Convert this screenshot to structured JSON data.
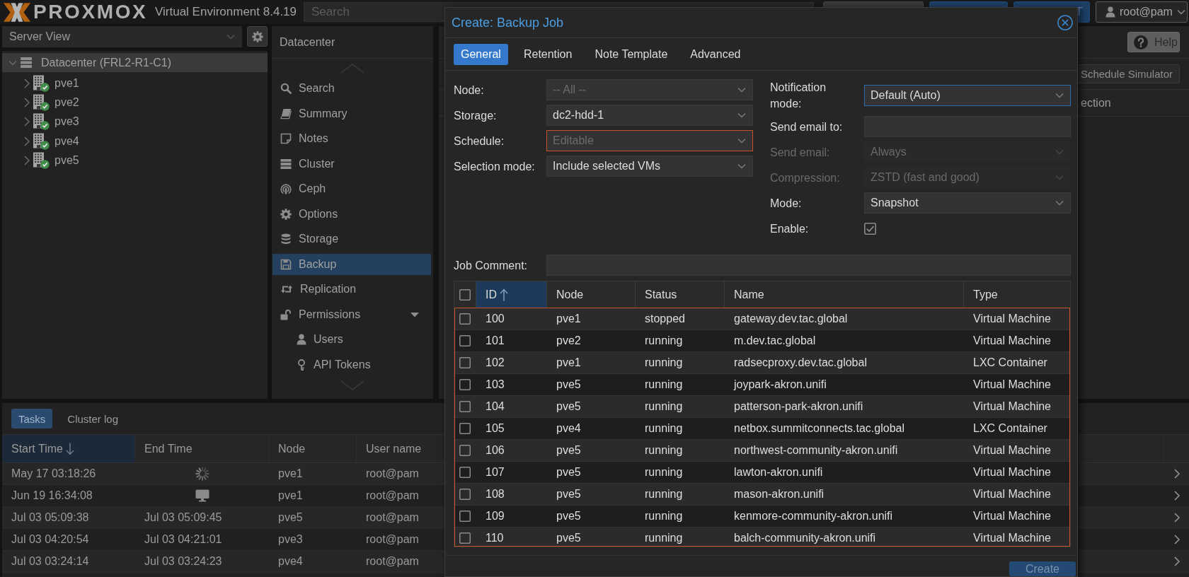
{
  "header": {
    "logo": "PROXMOX",
    "version": "Virtual Environment 8.4.19",
    "search": {
      "placeholder": "Search"
    },
    "buttons": [
      {
        "kind": "plain"
      },
      {
        "kind": "primary"
      },
      {
        "kind": "primary",
        "label": "T"
      }
    ],
    "user": "root@pam"
  },
  "tree": {
    "view": "Server View",
    "items": [
      {
        "label": "Datacenter (FRL2-R1-C1)",
        "selected": true,
        "expanded": true,
        "children": [
          {
            "label": "pve1",
            "selected": false,
            "expanded": false
          },
          {
            "label": "pve2",
            "selected": false,
            "expanded": false
          },
          {
            "label": "pve3",
            "selected": false,
            "expanded": false
          },
          {
            "label": "pve4",
            "selected": false,
            "expanded": false
          },
          {
            "label": "pve5",
            "selected": false,
            "expanded": false
          }
        ]
      }
    ]
  },
  "nav": {
    "title": "Datacenter",
    "items": [
      {
        "label": "Search",
        "selected": false
      },
      {
        "label": "Summary",
        "selected": false
      },
      {
        "label": "Notes",
        "selected": false
      },
      {
        "label": "Cluster",
        "selected": false
      },
      {
        "label": "Ceph",
        "selected": false
      },
      {
        "label": "Options",
        "selected": false
      },
      {
        "label": "Storage",
        "selected": false
      },
      {
        "label": "Backup",
        "selected": true
      },
      {
        "label": "Replication",
        "selected": false
      },
      {
        "label": "Permissions",
        "selected": false,
        "expanded": true,
        "children": [
          {
            "label": "Users",
            "selected": false
          },
          {
            "label": "API Tokens",
            "selected": false
          }
        ]
      }
    ]
  },
  "content": {
    "help_button": "Help",
    "simulator_button": "Schedule Simulator",
    "column_header": "ection"
  },
  "tasks": {
    "tabs": [
      {
        "label": "Tasks",
        "selected": true
      },
      {
        "label": "Cluster log",
        "selected": false
      }
    ],
    "columns": [
      {
        "label": "Start Time",
        "sorted": true,
        "descending": true
      },
      {
        "label": "End Time",
        "sorted": false
      },
      {
        "label": "Node",
        "sorted": false
      },
      {
        "label": "User name",
        "sorted": false
      }
    ],
    "rows": [
      {
        "start": "May 17 03:18:26",
        "kind": "running",
        "node": "pve1",
        "user": "root@pam"
      },
      {
        "start": "Jun 19 16:34:08",
        "kind": "console",
        "node": "pve1",
        "user": "root@pam"
      },
      {
        "start": "Jul 03 05:09:38",
        "kind": "finished",
        "end": "Jul 03 05:09:45",
        "node": "pve5",
        "user": "root@pam"
      },
      {
        "start": "Jul 03 04:20:54",
        "kind": "finished",
        "end": "Jul 03 04:21:01",
        "node": "pve3",
        "user": "root@pam"
      },
      {
        "start": "Jul 03 03:24:14",
        "kind": "finished",
        "end": "Jul 03 03:24:23",
        "node": "pve4",
        "user": "root@pam"
      }
    ]
  },
  "dialog": {
    "title": "Create: Backup Job",
    "tabs": [
      {
        "label": "General",
        "selected": true
      },
      {
        "label": "Retention",
        "selected": false
      },
      {
        "label": "Note Template",
        "selected": false
      },
      {
        "label": "Advanced",
        "selected": false
      }
    ],
    "left_fields": [
      {
        "label": "Node:",
        "kind": "combo",
        "placeholder": "-- All --",
        "disabled": false,
        "invalid": false,
        "focused": false
      },
      {
        "label": "Storage:",
        "kind": "combo",
        "value": "dc2-hdd-1",
        "disabled": false,
        "invalid": false,
        "focused": false
      },
      {
        "label": "Schedule:",
        "kind": "combo",
        "placeholder": "Editable",
        "disabled": false,
        "invalid": true,
        "focused": false
      },
      {
        "label": "Selection mode:",
        "kind": "combo",
        "value": "Include selected VMs",
        "disabled": false,
        "invalid": false,
        "focused": false
      }
    ],
    "right_fields": [
      {
        "label": "Notification mode:",
        "kind": "combo",
        "value": "Default (Auto)",
        "disabled": false,
        "invalid": false,
        "focused": true
      },
      {
        "label": "Send email to:",
        "kind": "text",
        "disabled": false,
        "invalid": false,
        "focused": false
      },
      {
        "label": "Send email:",
        "kind": "combo",
        "value": "Always",
        "disabled": true,
        "invalid": false,
        "focused": false
      },
      {
        "label": "Compression:",
        "kind": "combo",
        "value": "ZSTD (fast and good)",
        "disabled": true,
        "invalid": false,
        "focused": false
      },
      {
        "label": "Mode:",
        "kind": "combo",
        "value": "Snapshot",
        "disabled": false,
        "invalid": false,
        "focused": false
      },
      {
        "label": "Enable:",
        "kind": "checkbox",
        "checked": true
      }
    ],
    "comment": {
      "label": "Job Comment:",
      "kind": "text",
      "disabled": false,
      "invalid": false,
      "focused": false
    },
    "table": {
      "invalid": true,
      "all_checked": false,
      "columns": [
        {
          "label": "ID",
          "sorted": true,
          "descending": false
        },
        {
          "label": "Node",
          "sorted": false
        },
        {
          "label": "Status",
          "sorted": false
        },
        {
          "label": "Name",
          "sorted": false
        },
        {
          "label": "Type",
          "sorted": false
        }
      ],
      "rows": [
        {
          "checked": false,
          "id": "100",
          "node": "pve1",
          "status": "stopped",
          "name": "gateway.dev.tac.global",
          "type": "Virtual Machine"
        },
        {
          "checked": false,
          "id": "101",
          "node": "pve2",
          "status": "running",
          "name": "m.dev.tac.global",
          "type": "Virtual Machine"
        },
        {
          "checked": false,
          "id": "102",
          "node": "pve1",
          "status": "running",
          "name": "radsecproxy.dev.tac.global",
          "type": "LXC Container"
        },
        {
          "checked": false,
          "id": "103",
          "node": "pve5",
          "status": "running",
          "name": "joypark-akron.unifi",
          "type": "Virtual Machine"
        },
        {
          "checked": false,
          "id": "104",
          "node": "pve5",
          "status": "running",
          "name": "patterson-park-akron.unifi",
          "type": "Virtual Machine"
        },
        {
          "checked": false,
          "id": "105",
          "node": "pve4",
          "status": "running",
          "name": "netbox.summitconnects.tac.global",
          "type": "LXC Container"
        },
        {
          "checked": false,
          "id": "106",
          "node": "pve5",
          "status": "running",
          "name": "northwest-community-akron.unifi",
          "type": "Virtual Machine"
        },
        {
          "checked": false,
          "id": "107",
          "node": "pve5",
          "status": "running",
          "name": "lawton-akron.unifi",
          "type": "Virtual Machine"
        },
        {
          "checked": false,
          "id": "108",
          "node": "pve5",
          "status": "running",
          "name": "mason-akron.unifi",
          "type": "Virtual Machine"
        },
        {
          "checked": false,
          "id": "109",
          "node": "pve5",
          "status": "running",
          "name": "kenmore-community-akron.unifi",
          "type": "Virtual Machine"
        },
        {
          "checked": false,
          "id": "110",
          "node": "pve5",
          "status": "running",
          "name": "balch-community-akron.unifi",
          "type": "Virtual Machine"
        }
      ]
    },
    "create_button": {
      "label": "Create",
      "disabled": true
    }
  }
}
